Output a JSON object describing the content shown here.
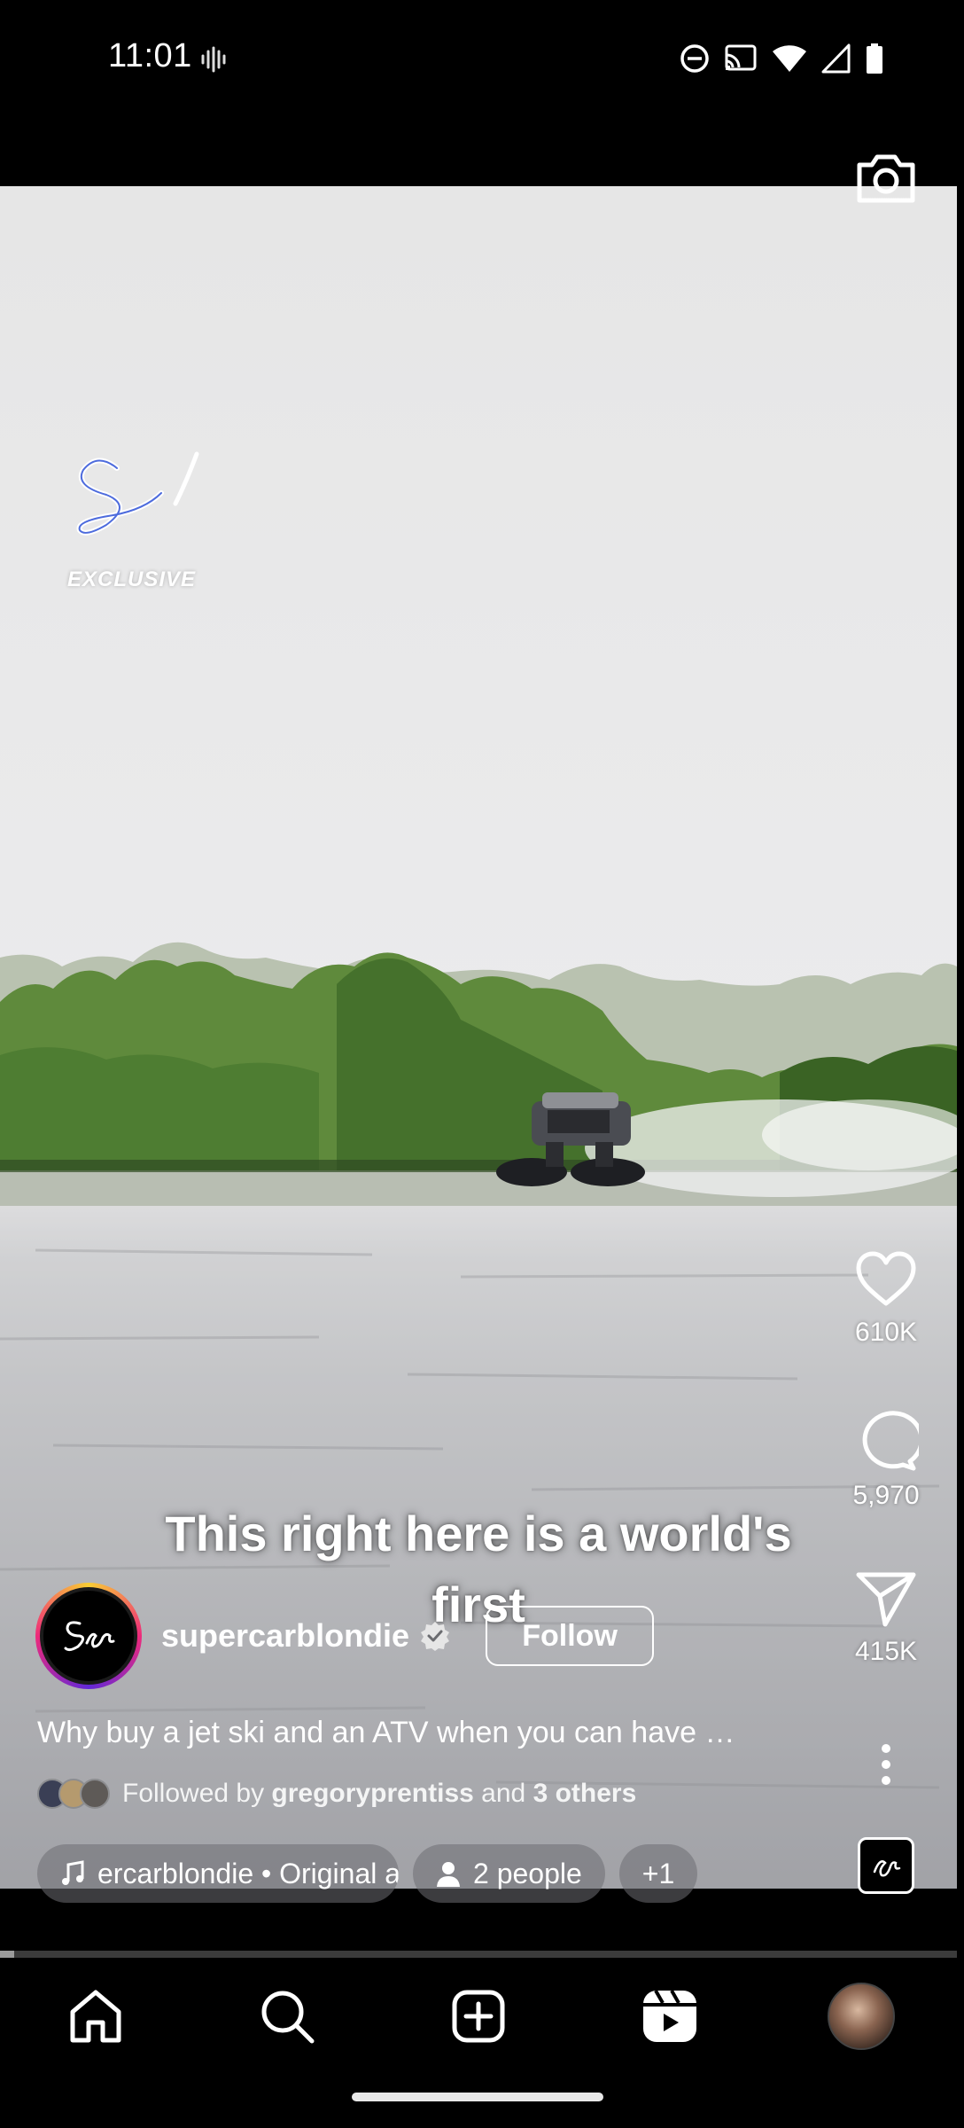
{
  "status_bar": {
    "time": "11:01",
    "icons": [
      "voice-activity-icon",
      "do-not-disturb-icon",
      "cast-icon",
      "wifi-icon",
      "signal-icon",
      "battery-icon"
    ]
  },
  "video": {
    "watermark_label": "EXCLUSIVE",
    "caption": "This right here is a world's first"
  },
  "actions": {
    "likes": "610K",
    "comments": "5,970",
    "shares": "415K"
  },
  "post": {
    "username": "supercarblondie",
    "follow_label": "Follow",
    "description": "Why buy a jet ski and an ATV when you can have …",
    "followed_by_prefix": "Followed by ",
    "followed_by_user": "gregoryprentiss",
    "followed_by_middle": " and ",
    "followed_by_others": "3 others"
  },
  "chips": {
    "audio": "ercarblondie • Original a",
    "people": "2 people",
    "more": "+1"
  },
  "progress": {
    "fraction": 0.015
  },
  "nav": {
    "items": [
      "home-icon",
      "search-icon",
      "create-icon",
      "reels-icon",
      "profile-avatar"
    ]
  },
  "colors": {
    "background": "#000000",
    "text": "#ffffff",
    "sky": "#e8e8e9",
    "water": "#a9aaae",
    "foliage": "#4f7a32"
  }
}
